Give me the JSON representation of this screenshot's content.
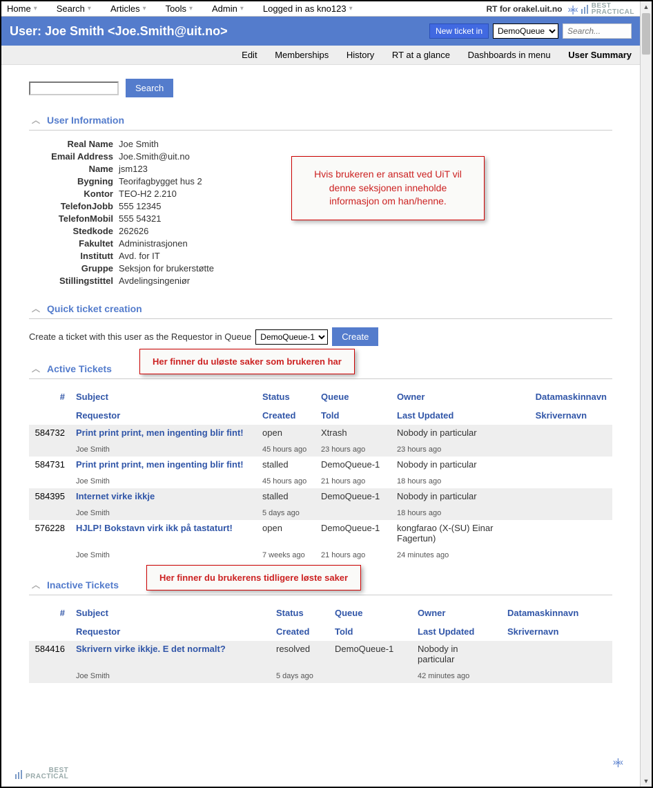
{
  "topmenu": {
    "items": [
      "Home",
      "Search",
      "Articles",
      "Tools",
      "Admin"
    ],
    "logged_in": "Logged in as kno123",
    "rt_label": "RT for orakel.uit.no"
  },
  "header": {
    "title": "User: Joe Smith <Joe.Smith@uit.no>",
    "new_ticket_btn": "New ticket in",
    "queue_sel": "DemoQueue",
    "search_placeholder": "Search..."
  },
  "subnav": {
    "items": [
      "Edit",
      "Memberships",
      "History",
      "RT at a glance",
      "Dashboards in menu",
      "User Summary"
    ]
  },
  "searchbox": {
    "btn": "Search"
  },
  "sections": {
    "userinfo": "User Information",
    "quick": "Quick ticket creation",
    "active": "Active Tickets",
    "inactive": "Inactive Tickets"
  },
  "user": {
    "fields": [
      {
        "label": "Real Name",
        "value": "Joe Smith"
      },
      {
        "label": "Email Address",
        "value": "Joe.Smith@uit.no"
      },
      {
        "label": "Name",
        "value": "jsm123"
      },
      {
        "label": "Bygning",
        "value": "Teorifagbygget hus 2"
      },
      {
        "label": "Kontor",
        "value": "TEO-H2 2.210"
      },
      {
        "label": "TelefonJobb",
        "value": "555 12345"
      },
      {
        "label": "TelefonMobil",
        "value": "555 54321"
      },
      {
        "label": "Stedkode",
        "value": "262626"
      },
      {
        "label": "Fakultet",
        "value": "Administrasjonen"
      },
      {
        "label": "Institutt",
        "value": "Avd. for IT"
      },
      {
        "label": "Gruppe",
        "value": "Seksjon for brukerstøtte"
      },
      {
        "label": "Stillingstittel",
        "value": "Avdelingsingeniør"
      }
    ]
  },
  "callouts": {
    "userinfo": "Hvis brukeren er ansatt ved UiT vil denne seksjonen inneholde informasjon om han/henne.",
    "active": "Her finner du uløste saker som brukeren har",
    "inactive": "Her finner du brukerens tidligere løste saker"
  },
  "quick": {
    "label_pre": "Create a ticket with this user as the Requestor in Queue",
    "queue_option": "DemoQueue-1",
    "btn": "Create"
  },
  "columns": {
    "id": "#",
    "subject": "Subject",
    "status": "Status",
    "queue": "Queue",
    "owner": "Owner",
    "datamaskin": "Datamaskinnavn",
    "requestor": "Requestor",
    "created": "Created",
    "told": "Told",
    "updated": "Last Updated",
    "skriver": "Skrivernavn"
  },
  "active_tickets": [
    {
      "id": "584732",
      "subject": "Print print print, men ingenting blir fint!",
      "requestor": "Joe Smith <Joe.Smith@uit.no>",
      "status": "open",
      "created": "45 hours ago",
      "queue": "Xtrash",
      "told": "23 hours ago",
      "owner": "Nobody in particular",
      "updated": "23 hours ago"
    },
    {
      "id": "584731",
      "subject": "Print print print, men ingenting blir fint!",
      "requestor": "Joe Smith <Joe.Smith@uit.no>",
      "status": "stalled",
      "created": "45 hours ago",
      "queue": "DemoQueue-1",
      "told": "21 hours ago",
      "owner": "Nobody in particular",
      "updated": "18 hours ago"
    },
    {
      "id": "584395",
      "subject": "Internet virke ikkje",
      "requestor": "Joe Smith <Joe.Smith@uit.no>",
      "status": "stalled",
      "created": "5 days ago",
      "queue": "DemoQueue-1",
      "told": "",
      "owner": "Nobody in particular",
      "updated": "18 hours ago"
    },
    {
      "id": "576228",
      "subject": "HJLP! Bokstavn virk ikk på tastaturt!",
      "requestor": "Joe Smith <Joe.Smith@uit.no>",
      "status": "open",
      "created": "7 weeks ago",
      "queue": "DemoQueue-1",
      "told": "21 hours ago",
      "owner": "kongfarao (X-(SU) Einar Fagertun)",
      "updated": "24 minutes ago"
    }
  ],
  "inactive_tickets": [
    {
      "id": "584416",
      "subject": "Skrivern virke ikkje. E det normalt?",
      "requestor": "Joe Smith <Joe.Smith@uit.no>",
      "status": "resolved",
      "created": "5 days ago",
      "queue": "DemoQueue-1",
      "told": "",
      "owner": "Nobody in particular",
      "updated": "42 minutes ago"
    }
  ]
}
